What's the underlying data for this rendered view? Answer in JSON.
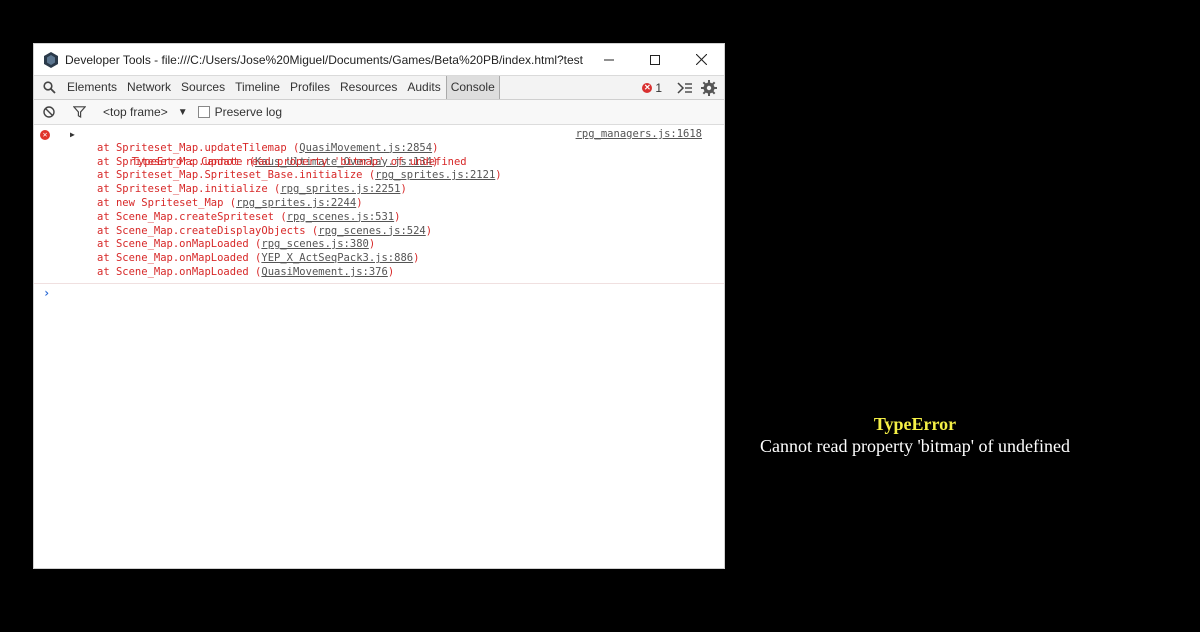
{
  "window": {
    "title": "Developer Tools - file:///C:/Users/Jose%20Miguel/Documents/Games/Beta%20PB/index.html?test"
  },
  "tabs": [
    "Elements",
    "Network",
    "Sources",
    "Timeline",
    "Profiles",
    "Resources",
    "Audits",
    "Console"
  ],
  "active_tab": "Console",
  "toolbar": {
    "error_count": "1"
  },
  "filter": {
    "frame": "<top frame>",
    "preserve_log": "Preserve log"
  },
  "console": {
    "error": {
      "message": "TypeError: Cannot read property 'bitmap' of undefined",
      "source": "rpg_managers.js:1618",
      "stack": [
        {
          "text": "at Spriteset_Map.updateTilemap (",
          "link": "QuasiMovement.js:2854",
          "end": ")"
        },
        {
          "text": "at Spriteset_Map.update (",
          "link": "Kaus_Ultimate_Overlay.js:134",
          "end": ")"
        },
        {
          "text": "at Spriteset_Map.Spriteset_Base.initialize (",
          "link": "rpg_sprites.js:2121",
          "end": ")"
        },
        {
          "text": "at Spriteset_Map.initialize (",
          "link": "rpg_sprites.js:2251",
          "end": ")"
        },
        {
          "text": "at new Spriteset_Map (",
          "link": "rpg_sprites.js:2244",
          "end": ")"
        },
        {
          "text": "at Scene_Map.createSpriteset (",
          "link": "rpg_scenes.js:531",
          "end": ")"
        },
        {
          "text": "at Scene_Map.createDisplayObjects (",
          "link": "rpg_scenes.js:524",
          "end": ")"
        },
        {
          "text": "at Scene_Map.onMapLoaded (",
          "link": "rpg_scenes.js:380",
          "end": ")"
        },
        {
          "text": "at Scene_Map.onMapLoaded (",
          "link": "YEP_X_ActSeqPack3.js:886",
          "end": ")"
        },
        {
          "text": "at Scene_Map.onMapLoaded (",
          "link": "QuasiMovement.js:376",
          "end": ")"
        }
      ]
    },
    "prompt": "›"
  },
  "overlay": {
    "title": "TypeError",
    "message": "Cannot read property 'bitmap' of undefined"
  },
  "colors": {
    "error_text": "#d72828",
    "overlay_title": "#f5f046",
    "overlay_text": "#ffffff",
    "background": "#000000"
  },
  "icons": {
    "app": "devtools-icon",
    "minimize": "minimize-icon",
    "maximize": "maximize-icon",
    "close": "close-icon",
    "search": "search-icon",
    "clear": "clear-console-icon",
    "filter": "filter-icon",
    "drawer": "drawer-icon",
    "settings": "gear-icon"
  }
}
